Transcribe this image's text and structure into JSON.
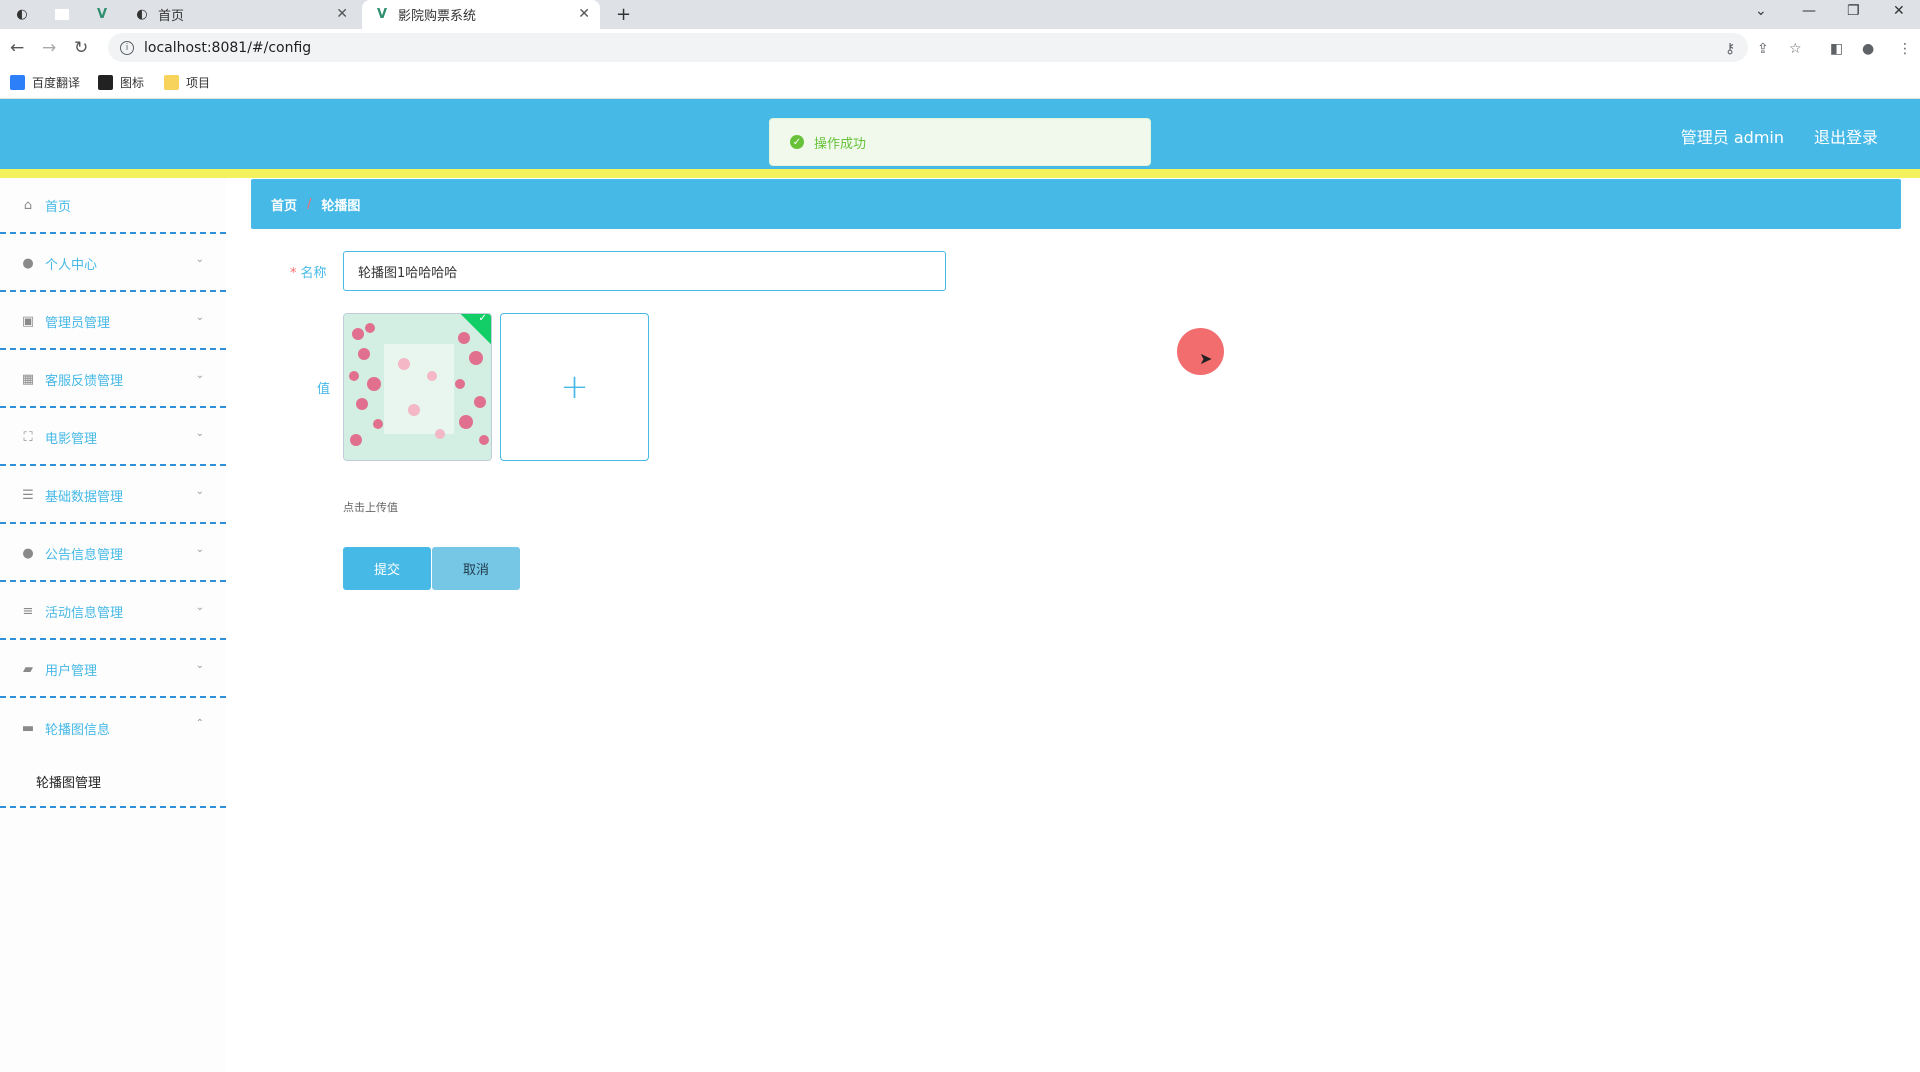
{
  "browser": {
    "tabs": [
      {
        "label": "首页"
      },
      {
        "label": "影院购票系统"
      }
    ],
    "new_tab": "+",
    "url": "localhost:8081/#/config",
    "bookmarks": [
      {
        "label": "百度翻译"
      },
      {
        "label": "图标"
      },
      {
        "label": "项目"
      }
    ]
  },
  "header": {
    "user": "管理员 admin",
    "logout": "退出登录",
    "toast": "操作成功",
    "accent": "#46b9e7",
    "stripe": "#f4f25c"
  },
  "sidebar": {
    "items": [
      {
        "label": "首页",
        "icon": "home-icon"
      },
      {
        "label": "个人中心",
        "icon": "user-icon"
      },
      {
        "label": "管理员管理",
        "icon": "clipboard-icon"
      },
      {
        "label": "客服反馈管理",
        "icon": "grid-icon"
      },
      {
        "label": "电影管理",
        "icon": "fullscreen-icon"
      },
      {
        "label": "基础数据管理",
        "icon": "sliders-icon"
      },
      {
        "label": "公告信息管理",
        "icon": "user-icon"
      },
      {
        "label": "活动信息管理",
        "icon": "list-icon"
      },
      {
        "label": "用户管理",
        "icon": "folder-icon"
      },
      {
        "label": "轮播图信息",
        "icon": "ticket-icon"
      }
    ],
    "sub_item": "轮播图管理"
  },
  "breadcrumb": {
    "home": "首页",
    "sep": "/",
    "current": "轮播图"
  },
  "form": {
    "required_mark": "*",
    "name_label": "名称",
    "name_value": "轮播图1哈哈哈哈",
    "value_label": "值",
    "upload_plus": "+",
    "upload_tip": "点击上传值",
    "submit": "提交",
    "cancel": "取消"
  }
}
